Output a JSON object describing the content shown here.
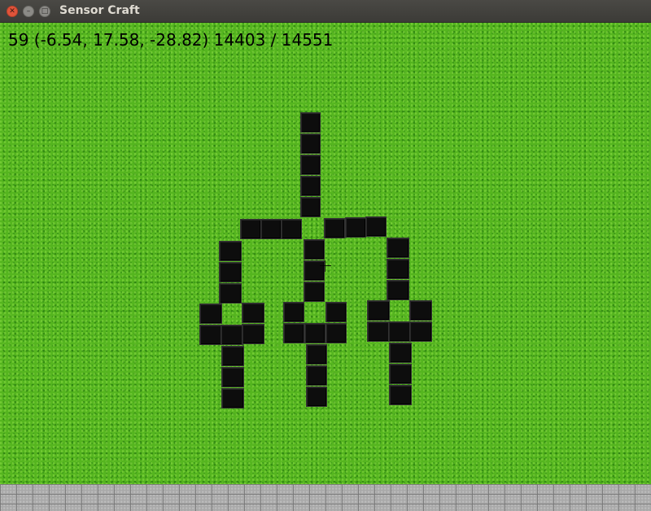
{
  "window": {
    "title": "Sensor Craft",
    "buttons": {
      "close_icon": "close-icon",
      "minimize_icon": "minimize-icon",
      "maximize_icon": "maximize-icon"
    }
  },
  "hud": {
    "text": "59 (-6.54, 17.58, -28.82) 14403 / 14551"
  },
  "colors": {
    "grass": "#55b51f",
    "block": "#0d0d0d",
    "stone_ground": "#a9a9a9"
  },
  "scene": {
    "block_material": "black-block",
    "terrain": "grass",
    "floor": "stone"
  }
}
